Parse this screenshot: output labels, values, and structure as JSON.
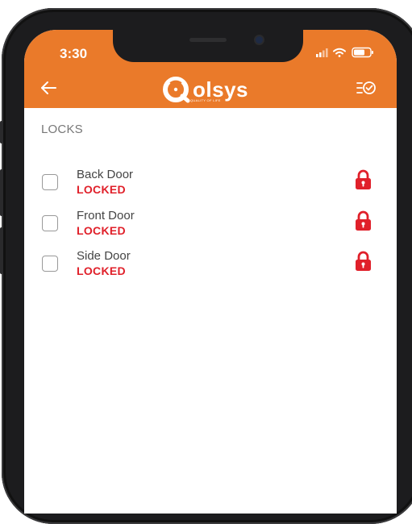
{
  "status_bar": {
    "time": "3:30"
  },
  "header": {
    "brand_name": "olsys",
    "brand_tagline": "QUALITY OF LIFE",
    "back_icon": "arrow-left-icon",
    "action_icon": "select-all-icon"
  },
  "section": {
    "title": "LOCKS"
  },
  "locks": [
    {
      "name": "Back Door",
      "status": "LOCKED"
    },
    {
      "name": "Front Door",
      "status": "LOCKED"
    },
    {
      "name": "Side Door",
      "status": "LOCKED"
    }
  ],
  "colors": {
    "header_bg": "#ea7a2a",
    "locked_red": "#e0202a",
    "text_gray": "#777777"
  }
}
